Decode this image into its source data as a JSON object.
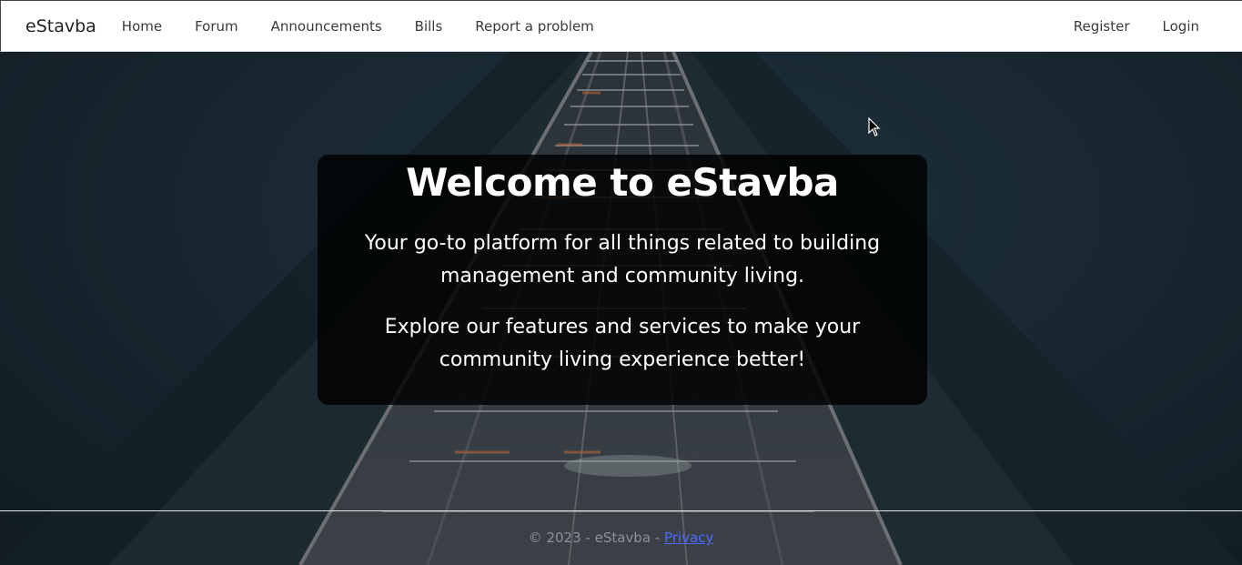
{
  "navbar": {
    "brand": "eStavba",
    "links": [
      "Home",
      "Forum",
      "Announcements",
      "Bills",
      "Report a problem"
    ],
    "right_links": [
      "Register",
      "Login"
    ]
  },
  "hero": {
    "title": "Welcome to eStavba",
    "paragraph1": "Your go-to platform for all things related to building management and community living.",
    "paragraph2": "Explore our features and services to make your community living experience better!"
  },
  "footer": {
    "text": "© 2023 - eStavba - ",
    "privacy_link": "Privacy"
  },
  "colors": {
    "navbar_bg": "#ffffff",
    "card_bg": "rgba(0,0,0,0.82)",
    "link": "#4d6bff",
    "footer_text": "#8a9299"
  },
  "icons": [
    "mouse-cursor-icon"
  ]
}
